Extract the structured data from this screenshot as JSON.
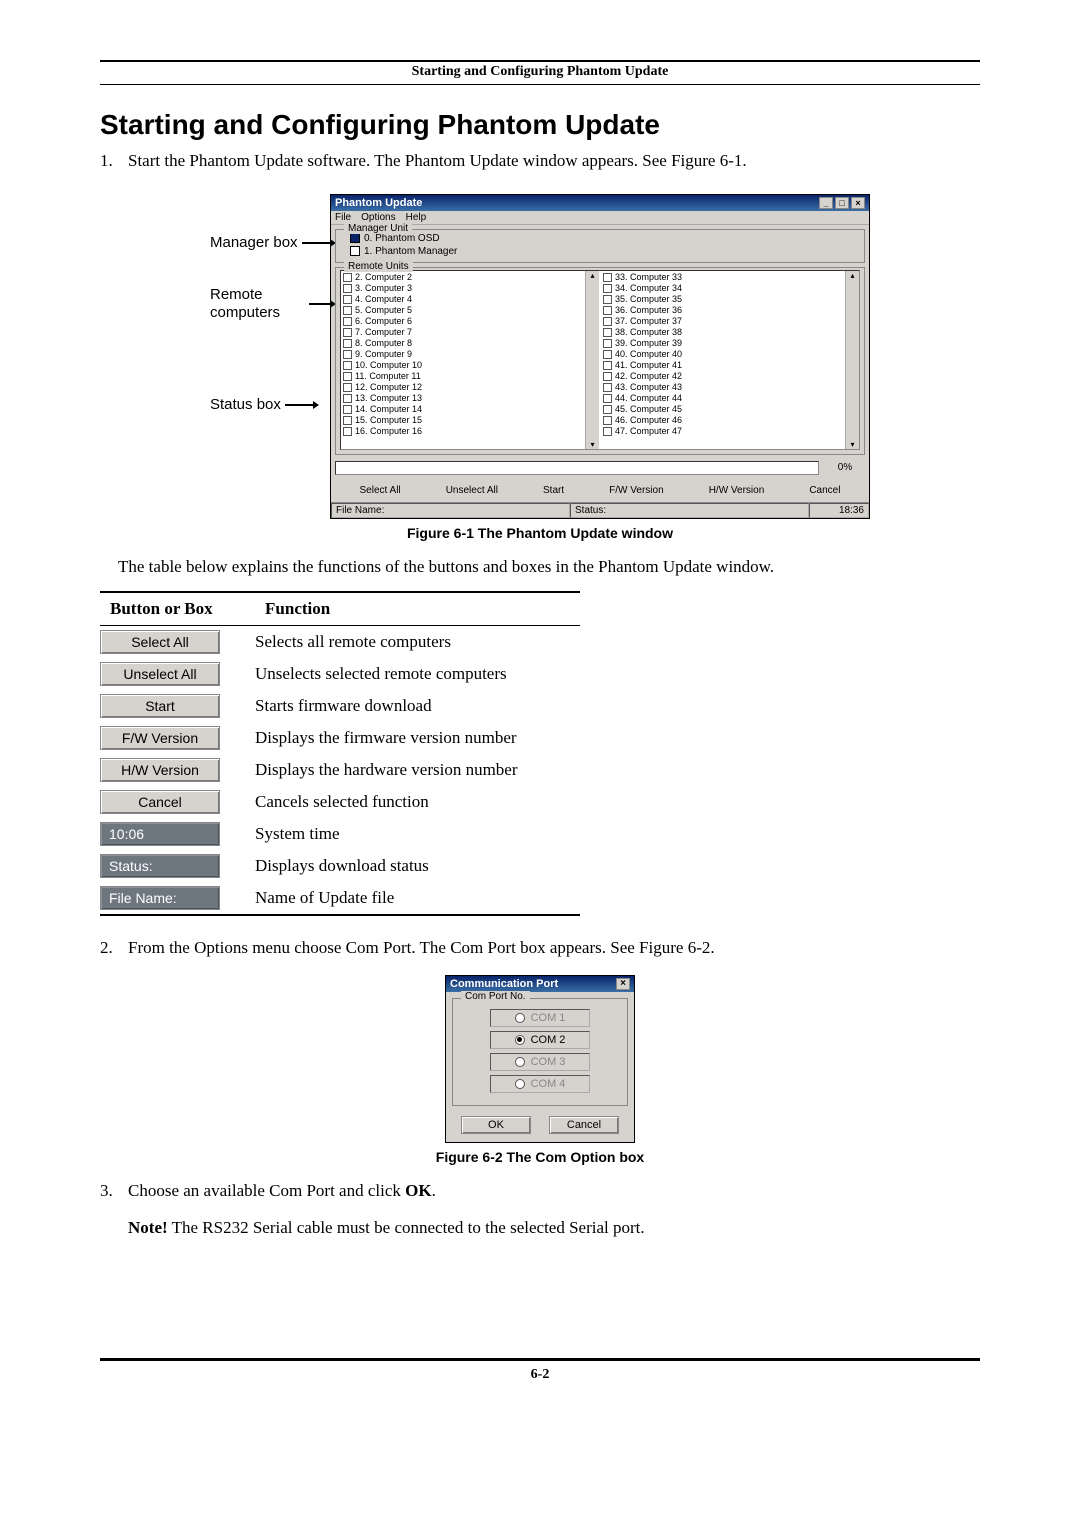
{
  "header_caption": "Starting and Configuring Phantom Update",
  "h1": "Starting and Configuring Phantom Update",
  "steps": {
    "s1_num": "1.",
    "s1_text": "Start the Phantom Update software. The Phantom Update window appears. See Figure 6-1.",
    "s2_num": "2.",
    "s2_text": "From the Options menu choose Com Port. The Com Port box appears. See Figure 6-2.",
    "s3_num": "3.",
    "s3_text_a": "Choose an available Com Port and click ",
    "s3_text_b": "OK",
    "s3_text_c": "."
  },
  "note_label": "Note!",
  "note_text": " The RS232 Serial cable must be connected to the selected Serial port.",
  "labels_left": {
    "manager": "Manager box",
    "remote": "Remote computers",
    "status": "Status box"
  },
  "phantom_win": {
    "title": "Phantom Update",
    "menu": [
      "File",
      "Options",
      "Help"
    ],
    "group_manager": "Manager Unit",
    "manager_rows": [
      "0. Phantom OSD",
      "1. Phantom Manager"
    ],
    "group_remote": "Remote Units",
    "remote_left": [
      "2. Computer 2",
      "3. Computer 3",
      "4. Computer 4",
      "5. Computer 5",
      "6. Computer 6",
      "7. Computer 7",
      "8. Computer 8",
      "9. Computer 9",
      "10. Computer 10",
      "11. Computer 11",
      "12. Computer 12",
      "13. Computer 13",
      "14. Computer 14",
      "15. Computer 15",
      "16. Computer 16"
    ],
    "remote_right": [
      "33. Computer 33",
      "34. Computer 34",
      "35. Computer 35",
      "36. Computer 36",
      "37. Computer 37",
      "38. Computer 38",
      "39. Computer 39",
      "40. Computer 40",
      "41. Computer 41",
      "42. Computer 42",
      "43. Computer 43",
      "44. Computer 44",
      "45. Computer 45",
      "46. Computer 46",
      "47. Computer 47"
    ],
    "progress_pct": "0%",
    "buttons": [
      "Select All",
      "Unselect All",
      "Start",
      "F/W Version",
      "H/W Version",
      "Cancel"
    ],
    "status_label_left": "File Name:",
    "status_label_mid": "Status:",
    "status_time": "18:36"
  },
  "fig1_caption": "Figure 6-1 The Phantom Update window",
  "para_after_fig1": "The table below explains the functions of the buttons and boxes in the Phantom Update window.",
  "table": {
    "head_button": "Button or Box",
    "head_function": "Function",
    "rows": [
      {
        "btn": "Select All",
        "dark": false,
        "fn": "Selects all remote computers"
      },
      {
        "btn": "Unselect All",
        "dark": false,
        "fn": "Unselects selected remote computers"
      },
      {
        "btn": "Start",
        "dark": false,
        "fn": "Starts firmware download"
      },
      {
        "btn": "F/W Version",
        "dark": false,
        "fn": "Displays the firmware version number"
      },
      {
        "btn": "H/W Version",
        "dark": false,
        "fn": "Displays the hardware version number"
      },
      {
        "btn": "Cancel",
        "dark": false,
        "fn": "Cancels selected function"
      },
      {
        "btn": "10:06",
        "dark": true,
        "fn": "System time"
      },
      {
        "btn": "Status:",
        "dark": true,
        "fn": "Displays download status"
      },
      {
        "btn": "File Name:",
        "dark": true,
        "fn": "Name of Update file"
      }
    ]
  },
  "dialog2": {
    "title": "Communication Port",
    "group": "Com Port No.",
    "options": [
      "COM 1",
      "COM 2",
      "COM 3",
      "COM 4"
    ],
    "selected_index": 1,
    "ok": "OK",
    "cancel": "Cancel"
  },
  "fig2_caption": "Figure 6-2 The Com Option box",
  "page_number": "6-2"
}
